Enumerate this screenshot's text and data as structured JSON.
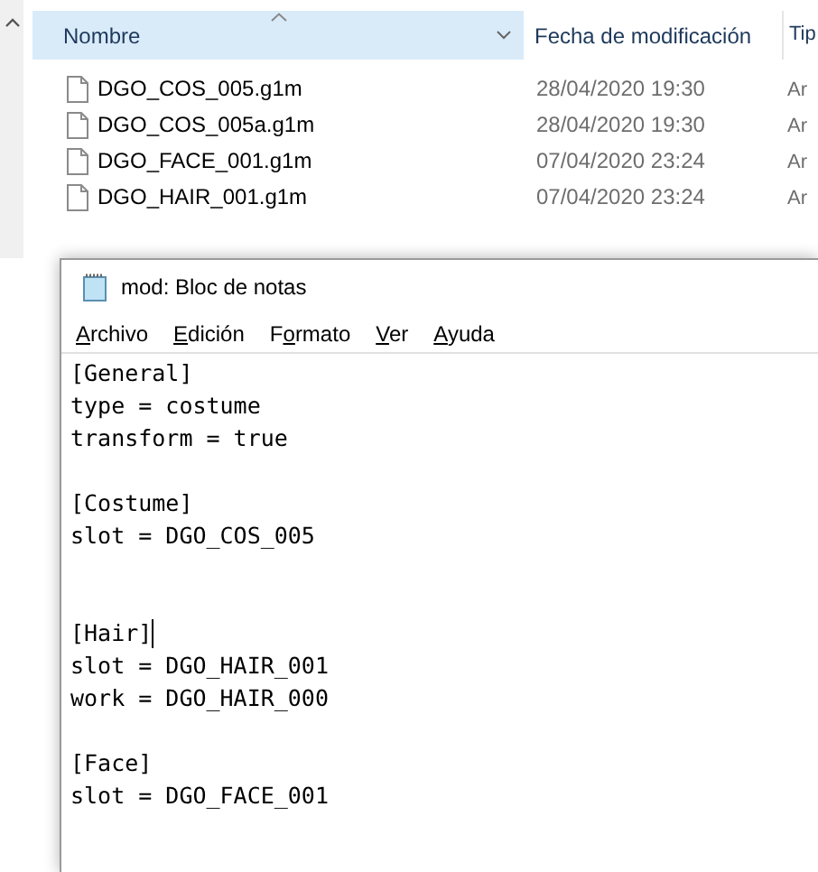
{
  "explorer": {
    "columns": [
      {
        "label": "Nombre",
        "selected": true,
        "sorted": true
      },
      {
        "label": "Fecha de modificación",
        "selected": false,
        "sorted": false
      },
      {
        "label": "Tip",
        "selected": false,
        "sorted": false
      }
    ],
    "rows": [
      {
        "name": "DGO_COS_005.g1m",
        "date": "28/04/2020 19:30",
        "type": "Ar"
      },
      {
        "name": "DGO_COS_005a.g1m",
        "date": "28/04/2020 19:30",
        "type": "Ar"
      },
      {
        "name": "DGO_FACE_001.g1m",
        "date": "07/04/2020 23:24",
        "type": "Ar"
      },
      {
        "name": "DGO_HAIR_001.g1m",
        "date": "07/04/2020 23:24",
        "type": "Ar"
      }
    ]
  },
  "notepad": {
    "title": "mod: Bloc de notas",
    "menu": [
      {
        "key": "A",
        "post": "rchivo"
      },
      {
        "key": "E",
        "post": "dición"
      },
      {
        "pre": "F",
        "key": "o",
        "post": "rmato"
      },
      {
        "key": "V",
        "post": "er"
      },
      {
        "key": "A",
        "post": "yuda"
      }
    ],
    "lines": [
      {
        "kind": "text",
        "text": "[General]",
        "caret": false
      },
      {
        "kind": "text",
        "text": "type = costume",
        "caret": false
      },
      {
        "kind": "text",
        "text": "transform = true",
        "caret": false
      },
      {
        "kind": "blank"
      },
      {
        "kind": "text",
        "text": "[Costume]",
        "caret": false
      },
      {
        "kind": "text",
        "text": "slot = DGO_COS_005",
        "caret": false
      },
      {
        "kind": "blank"
      },
      {
        "kind": "blank"
      },
      {
        "kind": "text",
        "text": "[Hair]",
        "caret": true
      },
      {
        "kind": "text",
        "text": "slot = DGO_HAIR_001",
        "caret": false
      },
      {
        "kind": "text",
        "text": "work = DGO_HAIR_000",
        "caret": false
      },
      {
        "kind": "blank"
      },
      {
        "kind": "text",
        "text": "[Face]",
        "caret": false
      },
      {
        "kind": "text",
        "text": "slot = DGO_FACE_001",
        "caret": false
      }
    ]
  }
}
